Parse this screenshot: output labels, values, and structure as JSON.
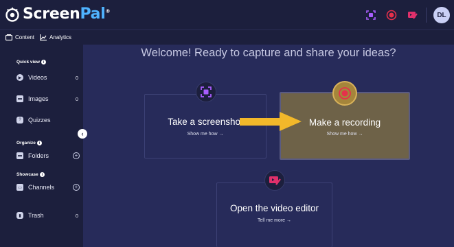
{
  "app": {
    "brand_part1": "Screen",
    "brand_part2": "Pal",
    "brand_reg": "®"
  },
  "topbar": {
    "icons": [
      "screenshot-icon",
      "record-icon",
      "editor-icon"
    ],
    "avatar_initials": "DL"
  },
  "subnav": {
    "content_label": "Content",
    "analytics_label": "Analytics"
  },
  "sidebar": {
    "quick_view_title": "Quick view",
    "videos_label": "Videos",
    "videos_count": "0",
    "images_label": "Images",
    "images_count": "0",
    "quizzes_label": "Quizzes",
    "organize_title": "Organize",
    "folders_label": "Folders",
    "showcase_title": "Showcase",
    "channels_label": "Channels",
    "trash_label": "Trash",
    "trash_count": "0",
    "collapse_glyph": "‹"
  },
  "main": {
    "welcome": "Welcome! Ready to capture and share your ideas?",
    "screenshot_title": "Take a screenshot",
    "screenshot_link": "Show me how →",
    "recording_title": "Make a recording",
    "recording_link": "Show me how →",
    "editor_title": "Open the video editor",
    "editor_link": "Tell me more →"
  },
  "colors": {
    "background": "#272b5a",
    "sidebar": "#1c1f3d",
    "accent_blue": "#4fb3ff",
    "record_red": "#e5304b",
    "highlight_card": "#6e6248",
    "arrow_yellow": "#f2b82a",
    "editor_pink": "#e0306b",
    "screenshot_purple": "#a95dfd"
  }
}
